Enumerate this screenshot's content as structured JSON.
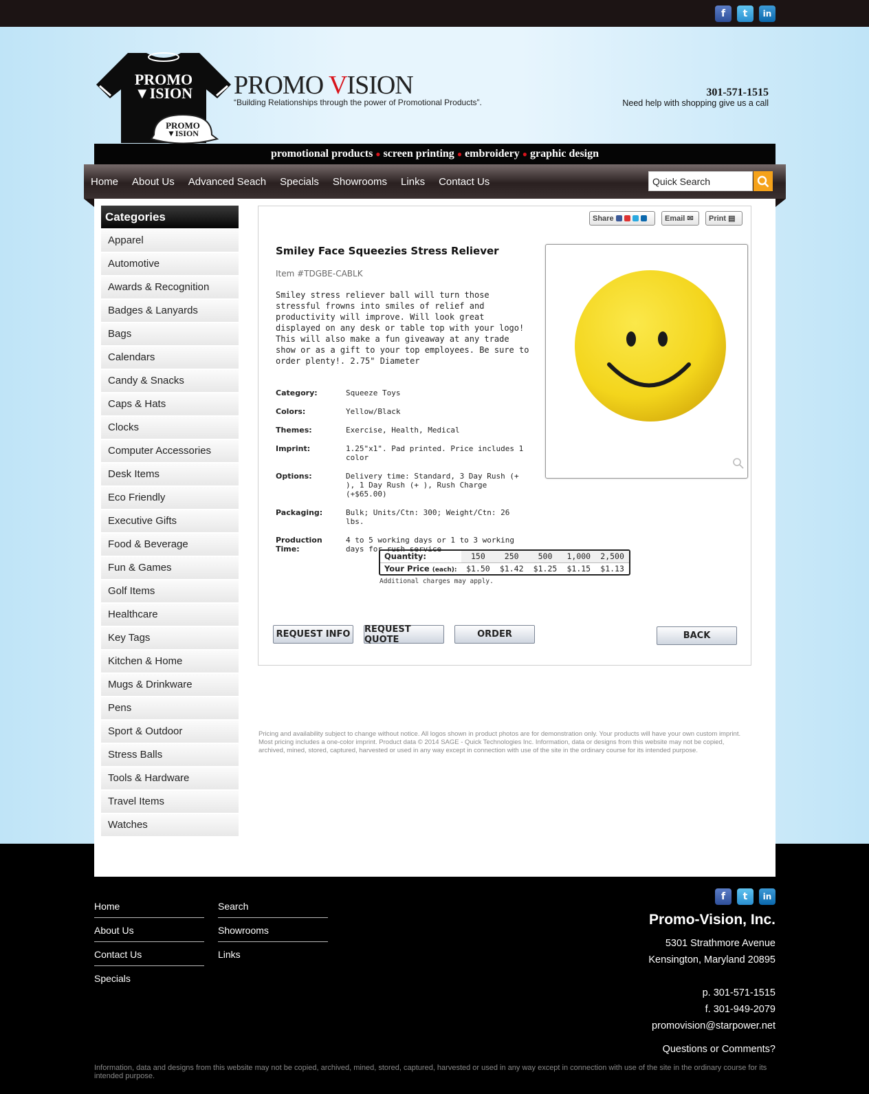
{
  "social": [
    "facebook-icon",
    "twitter-icon",
    "linkedin-icon"
  ],
  "header": {
    "brand_a": "PROMO ",
    "brand_v": "V",
    "brand_b": "ISION",
    "tagline": "“Building Relationships through the power of Promotional Products”.",
    "phone": "301-571-1515",
    "help": "Need help with shopping give us a call"
  },
  "services": [
    "promotional products",
    "screen printing",
    "embroidery",
    "graphic design"
  ],
  "nav": {
    "items": [
      "Home",
      "About Us",
      "Advanced Seach",
      "Specials",
      "Showrooms",
      "Links",
      "Contact Us"
    ],
    "search_value": "Quick Search"
  },
  "categories": {
    "title": "Categories",
    "items": [
      "Apparel",
      "Automotive",
      "Awards & Recognition",
      "Badges & Lanyards",
      "Bags",
      "Calendars",
      "Candy & Snacks",
      "Caps & Hats",
      "Clocks",
      "Computer Accessories",
      "Desk Items",
      "Eco Friendly",
      "Executive Gifts",
      "Food & Beverage",
      "Fun & Games",
      "Golf Items",
      "Healthcare",
      "Key Tags",
      "Kitchen & Home",
      "Mugs & Drinkware",
      "Pens",
      "Sport & Outdoor",
      "Stress Balls",
      "Tools & Hardware",
      "Travel Items",
      "Watches"
    ]
  },
  "tools": {
    "share": "Share",
    "email": "Email",
    "print": "Print"
  },
  "product": {
    "title": "Smiley Face Squeezies Stress Reliever",
    "item": "Item #TDGBE-CABLK",
    "description": "Smiley stress reliever ball will turn those stressful frowns into smiles of relief and productivity will improve. Will look great displayed on any desk or table top with your logo! This will also make a fun giveaway at any trade show or as a gift to your top employees. Be sure to order plenty!. 2.75\" Diameter",
    "specs": [
      {
        "label": "Category:",
        "value": "Squeeze Toys"
      },
      {
        "label": "Colors:",
        "value": "Yellow/Black"
      },
      {
        "label": "Themes:",
        "value": "Exercise, Health, Medical"
      },
      {
        "label": "Imprint:",
        "value": "1.25\"x1\". Pad printed. Price includes 1 color"
      },
      {
        "label": "Options:",
        "value": "Delivery time: Standard, 3 Day Rush (+ ), 1 Day Rush (+ ), Rush Charge (+$65.00)"
      },
      {
        "label": "Packaging:",
        "value": "Bulk; Units/Ctn: 300; Weight/Ctn: 26 lbs."
      },
      {
        "label": "Production Time:",
        "value": "4 to 5 working days or 1 to 3 working days for rush service"
      }
    ]
  },
  "pricing": {
    "qty_label": "Quantity:",
    "price_label": "Your Price",
    "each": "(each):",
    "quantities": [
      "150",
      "250",
      "500",
      "1,000",
      "2,500"
    ],
    "prices": [
      "$1.50",
      "$1.42",
      "$1.25",
      "$1.15",
      "$1.13"
    ],
    "note": "Additional charges may apply."
  },
  "buttons": {
    "request_info": "REQUEST INFO",
    "request_quote": "REQUEST QUOTE",
    "order": "ORDER",
    "back": "BACK"
  },
  "legal": "Pricing and availability subject to change without notice.  All logos shown in product photos are for demonstration only.  Your products will have your own custom imprint.  Most pricing includes a one-color imprint.  Product data © 2014 SAGE - Quick Technologies Inc.  Information, data or designs from this website may not be copied, archived, mined, stored, captured, harvested or used in any way except in connection with use of the site in the ordinary course for its intended purpose.",
  "footer": {
    "col1": [
      "Home",
      "About Us",
      "Contact Us",
      "Specials"
    ],
    "col2": [
      "Search",
      "Showrooms",
      "Links"
    ],
    "company": "Promo-Vision, Inc.",
    "address1": "5301 Strathmore Avenue",
    "address2": "Kensington, Maryland 20895",
    "phone": "p. 301-571-1515",
    "fax": "f. 301-949-2079",
    "email": "promovision@starpower.net",
    "questions": "Questions or Comments?",
    "copy": "Information, data and designs from this website may not be copied, archived, mined, stored, captured, harvested or used in any way except in connection with use of the site in the ordinary course for its intended purpose."
  },
  "colors": {
    "accent_red": "#d8141c",
    "search_orange": "#f5a21a",
    "smiley_yellow": "#f3d51c"
  }
}
